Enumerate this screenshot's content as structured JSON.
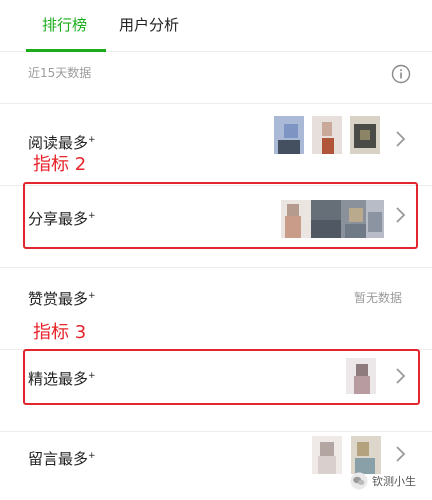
{
  "tabs": [
    {
      "label": "排行榜",
      "active": true
    },
    {
      "label": "用户分析",
      "active": false
    }
  ],
  "subheader": {
    "text": "近15天数据",
    "info_icon": "info-icon"
  },
  "rows": [
    {
      "label": "阅读最多",
      "marker": "+",
      "has_avatars": true
    },
    {
      "label": "分享最多",
      "marker": "+",
      "has_avatars": true
    },
    {
      "label": "赞赏最多",
      "marker": "+",
      "empty_text": "暂无数据"
    },
    {
      "label": "精选最多",
      "marker": "+",
      "has_avatars": true
    },
    {
      "label": "留言最多",
      "marker": "+",
      "has_avatars": true
    }
  ],
  "annotations": [
    {
      "text": "指标 2"
    },
    {
      "text": "指标 3"
    }
  ],
  "watermark": {
    "text": "钦测小生"
  },
  "colors": {
    "accent": "#1aad19",
    "annotation_red": "#e3262d",
    "muted": "#9b9b9b"
  }
}
